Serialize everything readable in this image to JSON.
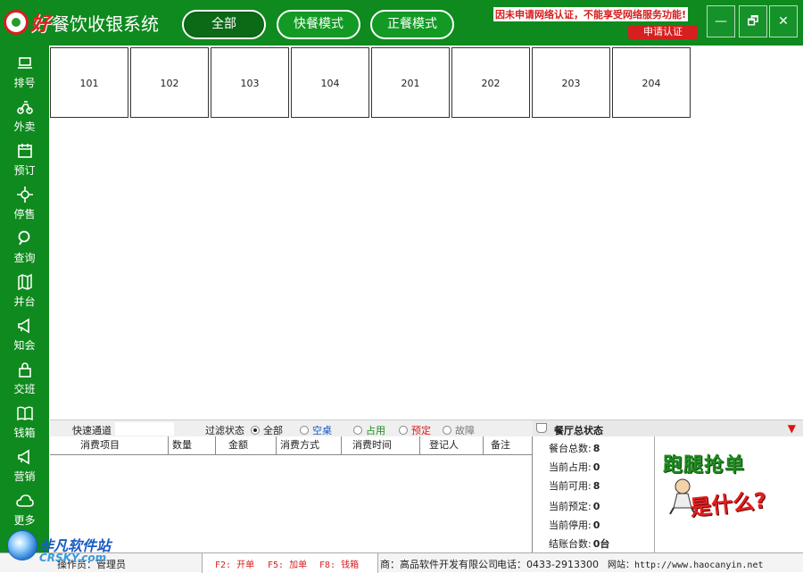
{
  "header": {
    "logo_hao": "好",
    "logo_rest": "餐饮收银系统",
    "modes": [
      "全部",
      "快餐模式",
      "正餐模式"
    ],
    "notice": "因未申请网络认证，不能享受网络服务功能!",
    "apply_label": "申请认证",
    "win_min": "—",
    "win_max": "🗗",
    "win_close": "✕"
  },
  "sidebar": {
    "items": [
      {
        "label": "排号",
        "icon": "laptop-icon"
      },
      {
        "label": "外卖",
        "icon": "scooter-icon"
      },
      {
        "label": "预订",
        "icon": "calendar-icon"
      },
      {
        "label": "停售",
        "icon": "crosshair-icon"
      },
      {
        "label": "查询",
        "icon": "search-icon"
      },
      {
        "label": "并台",
        "icon": "map-icon"
      },
      {
        "label": "知会",
        "icon": "megaphone-icon"
      },
      {
        "label": "交班",
        "icon": "lock-icon"
      },
      {
        "label": "钱箱",
        "icon": "book-icon"
      },
      {
        "label": "营销",
        "icon": "megaphone-icon"
      },
      {
        "label": "更多",
        "icon": "cloud-icon"
      }
    ]
  },
  "tables": [
    "101",
    "102",
    "103",
    "104",
    "201",
    "202",
    "203",
    "204"
  ],
  "filter": {
    "quick_label": "快速通道",
    "status_label": "过滤状态",
    "options": [
      {
        "label": "全部",
        "color": "#222222",
        "checked": true
      },
      {
        "label": "空桌",
        "color": "#1a5cc4",
        "checked": false
      },
      {
        "label": "占用",
        "color": "#1f8a1f",
        "checked": false
      },
      {
        "label": "预定",
        "color": "#d61f1f",
        "checked": false
      },
      {
        "label": "故障",
        "color": "#777777",
        "checked": false
      }
    ]
  },
  "consume_columns": [
    "消费项目",
    "数量",
    "金额",
    "消费方式",
    "消费时间",
    "登记人",
    "备注"
  ],
  "status_panel": {
    "title": "餐厅总状态",
    "arrow": "▼",
    "rows": [
      {
        "label": "餐台总数:",
        "value": "8"
      },
      {
        "label": "当前占用:",
        "value": "0"
      },
      {
        "label": "当前可用:",
        "value": "8"
      },
      {
        "label": "当前预定:",
        "value": "0"
      },
      {
        "label": "当前停用:",
        "value": "0"
      },
      {
        "label": "结账台数:",
        "value": "0台"
      }
    ]
  },
  "ad": {
    "line1": "跑腿抢单",
    "line2": "是什么?"
  },
  "statusbar": {
    "operator": "操作员：管理员",
    "keys": [
      "F2: 开单",
      "F5: 加单",
      "F8: 钱箱"
    ],
    "company": "商：高品软件开发有限公司",
    "phone": "电话：0433-2913300",
    "site": "网站：http://www.haocanyin.net"
  },
  "watermark": {
    "line1": "非凡软件站",
    "line2": "CRSKY.com"
  },
  "colors": {
    "brand_green": "#0f8a1e",
    "alert_red": "#d61f1f"
  }
}
